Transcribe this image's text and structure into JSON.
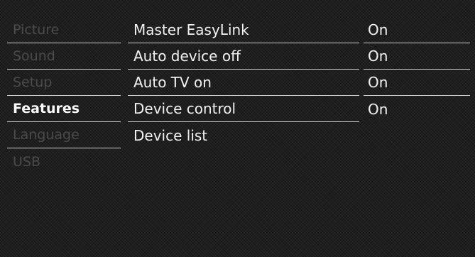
{
  "categories": [
    {
      "label": "Picture"
    },
    {
      "label": "Sound"
    },
    {
      "label": "Setup"
    },
    {
      "label": "Features"
    },
    {
      "label": "Language"
    },
    {
      "label": "USB"
    }
  ],
  "selected_category": "Features",
  "items": [
    {
      "label": "Master EasyLink",
      "value": "On"
    },
    {
      "label": "Auto device off",
      "value": "On"
    },
    {
      "label": "Auto TV on",
      "value": "On"
    },
    {
      "label": "Device control",
      "value": "On"
    },
    {
      "label": "Device list",
      "value": ""
    }
  ]
}
